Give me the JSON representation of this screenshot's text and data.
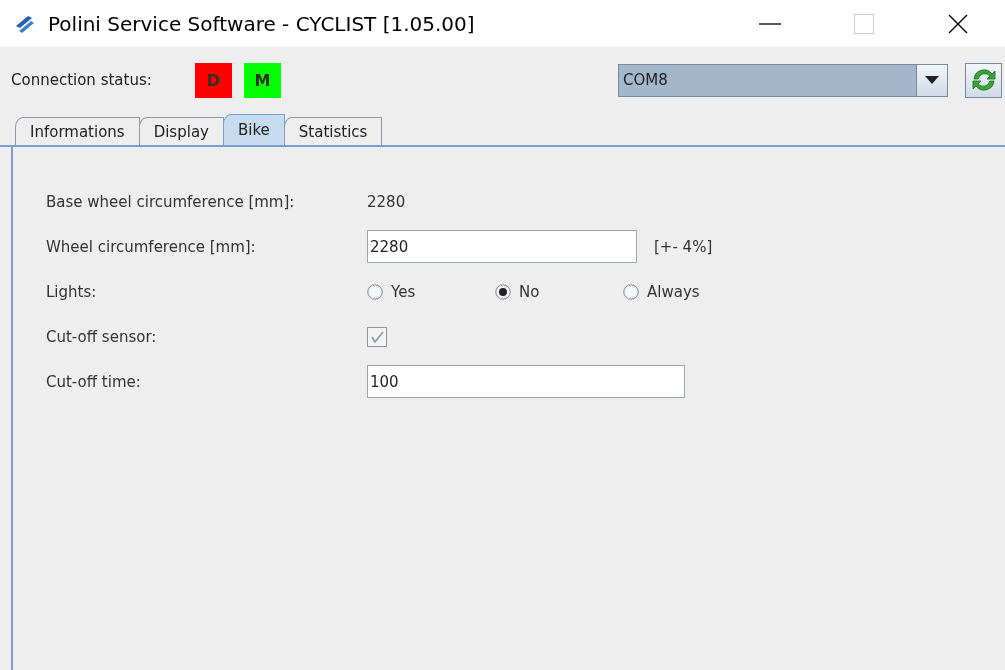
{
  "window": {
    "title": "Polini Service Software - CYCLIST [1.05.00]"
  },
  "connection": {
    "label": "Connection status:",
    "indicators": [
      {
        "text": "D",
        "color": "#ff0000"
      },
      {
        "text": "M",
        "color": "#00ff00"
      }
    ],
    "port": {
      "value": "COM8"
    }
  },
  "tabs": [
    {
      "label": "Informations",
      "selected": false
    },
    {
      "label": "Display",
      "selected": false
    },
    {
      "label": "Bike",
      "selected": true
    },
    {
      "label": "Statistics",
      "selected": false
    }
  ],
  "fields": [
    {
      "kind": "text",
      "label": "Base wheel circumference [mm]:",
      "value": "2280"
    },
    {
      "kind": "input",
      "label": "Wheel circumference [mm]:",
      "value": "2280",
      "hint": "[+- 4%]",
      "wide": false
    },
    {
      "kind": "radio",
      "label": "Lights:",
      "options": [
        {
          "label": "Yes",
          "selected": false
        },
        {
          "label": "No",
          "selected": true
        },
        {
          "label": "Always",
          "selected": false
        }
      ]
    },
    {
      "kind": "checkbox",
      "label": "Cut-off sensor:",
      "checked": true,
      "disabled": true
    },
    {
      "kind": "input",
      "label": "Cut-off time:",
      "value": "100",
      "wide": true
    }
  ]
}
